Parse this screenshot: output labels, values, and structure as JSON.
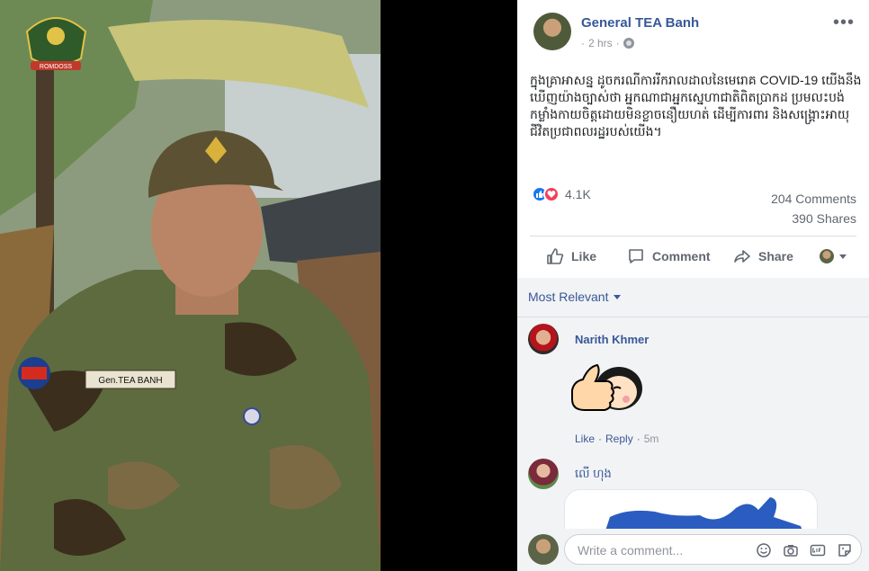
{
  "photo": {
    "name_tape": "Gen.TEA BANH",
    "emblem_banner": "ROMDOSS"
  },
  "post": {
    "author": "General TEA Banh",
    "time": "2 hrs",
    "more_label": "•••",
    "text": "ក្នុងគ្រាអាសន្ន ដូចករណីការរីករាលដាលនៃមេរោគ COVID-19 យើងនឹងឃើញយ៉ាងច្បាស់ថា អ្នកណាជាអ្នកស្នេហាជាតិពិតប្រាកដ ប្រមលះបង់កម្លាំងកាយចិត្តដោយមិនខ្លាចនឿយហត់ ដើម្បីការពារ និងសង្គ្រោះអាយុជីវិតប្រជាពលរដ្ឋរបស់យើង។",
    "reaction_count": "4.1K",
    "comments_count": "204 Comments",
    "shares_count": "390 Shares"
  },
  "actions": {
    "like": "Like",
    "comment": "Comment",
    "share": "Share"
  },
  "comments": {
    "sort_label": "Most Relevant",
    "items": [
      {
        "name": "Narith Khmer",
        "like": "Like",
        "sep": "·",
        "reply": "Reply",
        "time": "5m"
      },
      {
        "name": "លើ ហុង"
      }
    ],
    "write_placeholder": "Write a comment..."
  },
  "colors": {
    "link": "#385898",
    "like_blue": "#1877f2",
    "love_red": "#f33e58"
  },
  "icons": [
    "globe-icon",
    "like-icon",
    "comment-icon",
    "share-icon",
    "emoji-icon",
    "camera-icon",
    "gif-icon",
    "sticker-icon"
  ]
}
